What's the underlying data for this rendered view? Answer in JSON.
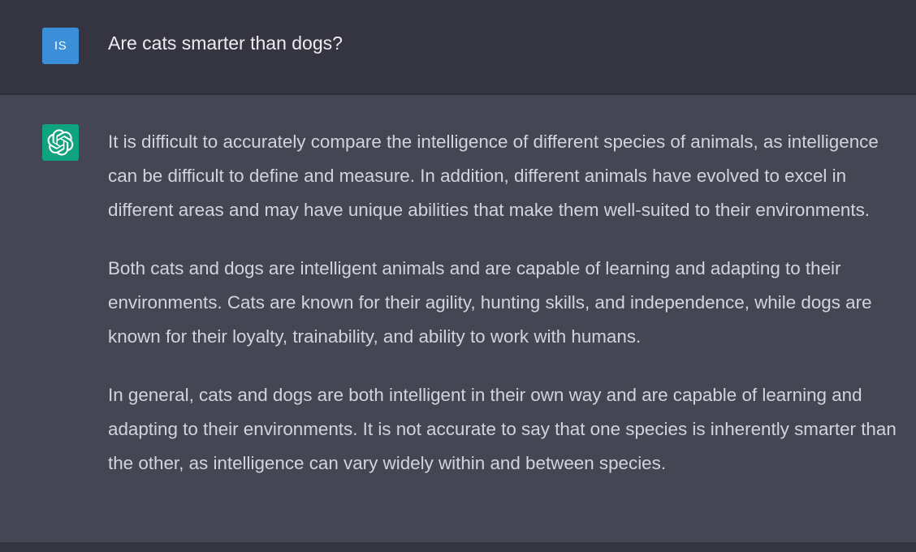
{
  "conversation": {
    "user": {
      "avatar_initials": "IS",
      "message": "Are cats smarter than dogs?"
    },
    "assistant": {
      "avatar_icon": "openai-logo-icon",
      "paragraphs": [
        "It is difficult to accurately compare the intelligence of different species of animals, as intelligence can be difficult to define and measure. In addition, different animals have evolved to excel in different areas and may have unique abilities that make them well-suited to their environments.",
        "Both cats and dogs are intelligent animals and are capable of learning and adapting to their environments. Cats are known for their agility, hunting skills, and independence, while dogs are known for their loyalty, trainability, and ability to work with humans.",
        "In general, cats and dogs are both intelligent in their own way and are capable of learning and adapting to their environments. It is not accurate to say that one species is inherently smarter than the other, as intelligence can vary widely within and between species."
      ]
    }
  },
  "colors": {
    "user_bg": "#343541",
    "assistant_bg": "#444654",
    "user_avatar": "#3a8fd8",
    "bot_avatar": "#10a37f",
    "text": "#d1d5db"
  }
}
